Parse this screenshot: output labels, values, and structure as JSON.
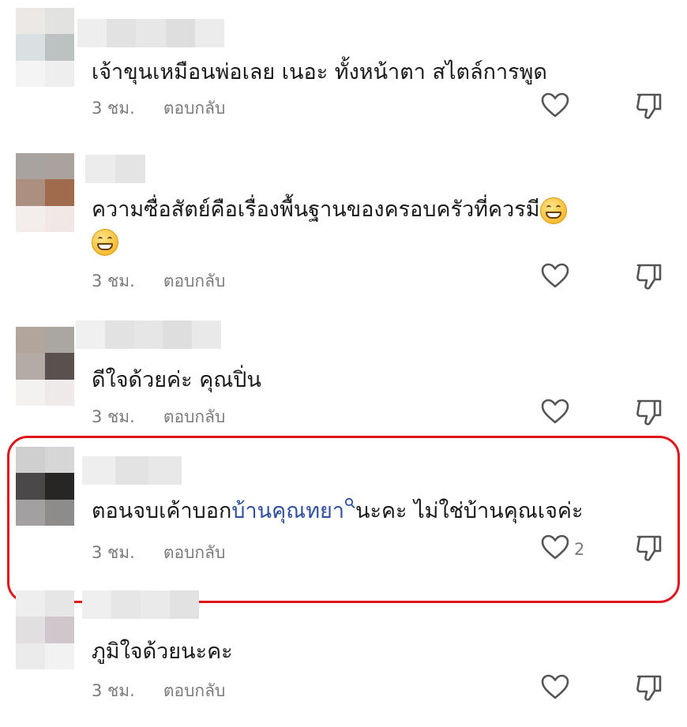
{
  "comments": [
    {
      "text": "เจ้าขุนเหมือนพ่อเลย เนอะ ทั้งหน้าตา สไตล์การพูด",
      "time": "3 ชม.",
      "reply": "ตอบกลับ",
      "likes": ""
    },
    {
      "text": "ความซื่อสัตย์คือเรื่องพื้นฐานของครอบครัวที่ควรมี",
      "time": "3 ชม.",
      "reply": "ตอบกลับ",
      "likes": ""
    },
    {
      "text": "ดีใจด้วยค่ะ คุณปิ่น",
      "time": "3 ชม.",
      "reply": "ตอบกลับ",
      "likes": ""
    },
    {
      "text_before": "ตอนจบเค้าบอก",
      "text_link": "บ้านคุณทยา",
      "text_after": "นะคะ ไม่ใช่บ้านคุณเจค่ะ",
      "time": "3 ชม.",
      "reply": "ตอบกลับ",
      "likes": "2"
    },
    {
      "text": "ภูมิใจด้วยนะคะ",
      "time": "3 ชม.",
      "reply": "ตอบกลับ",
      "likes": ""
    }
  ],
  "icons": {
    "like": "heart-outline-icon",
    "dislike": "thumbs-down-outline-icon",
    "emoji": "grinning-face-emoji",
    "link_search": "search-icon"
  },
  "colors": {
    "link": "#2f4f9e",
    "highlight": "#e0141c",
    "meta": "#7a7a7a"
  }
}
